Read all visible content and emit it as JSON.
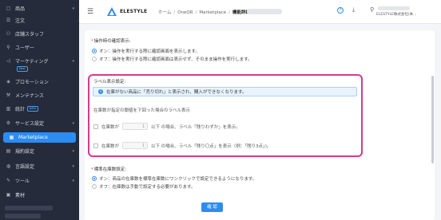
{
  "sidebar": {
    "items": [
      {
        "icon": "box-icon",
        "label": "商品",
        "chevron": true
      },
      {
        "icon": "list-icon",
        "label": "注文",
        "chevron": false
      },
      {
        "icon": "users-icon",
        "label": "店舗スタッフ",
        "chevron": false
      },
      {
        "icon": "user-icon",
        "label": "ユーザー",
        "chevron": false
      },
      {
        "icon": "megaphone-icon",
        "label": "マーケティング",
        "chevron": true,
        "sub_badge": "New"
      },
      {
        "icon": "gift-icon",
        "label": "プロモーション",
        "chevron": false
      },
      {
        "icon": "wrench-icon",
        "label": "メンテナンス",
        "chevron": false
      },
      {
        "icon": "chart-icon",
        "label": "統計",
        "chevron": false,
        "badge": "beta"
      },
      {
        "icon": "gear-icon",
        "label": "サービス設定",
        "chevron": true
      },
      {
        "icon": "store-icon",
        "label": "Marketplace",
        "chevron": false,
        "active": true
      },
      {
        "icon": "doc-icon",
        "label": "規約設定",
        "chevron": true
      },
      {
        "icon": "globe-icon",
        "label": "言語設定",
        "chevron": true
      },
      {
        "icon": "tool-icon",
        "label": "ツール",
        "chevron": true
      },
      {
        "icon": "image-icon",
        "label": "素材",
        "chevron": false
      }
    ]
  },
  "header": {
    "brand": "ELESTYLE",
    "breadcrumb": [
      "ホーム",
      "OneQR",
      "Marketplace",
      "機能詳細"
    ],
    "company": "ELESTYLE株式会社(本..."
  },
  "operation_confirm": {
    "title": "操作時の確認表示:",
    "options": [
      {
        "label": "オン：操作を実行する際に確認画面を表示します。",
        "selected": true
      },
      {
        "label": "オフ：操作を実行する際に確認画面は表示せず、そのまま操作を実行します。",
        "selected": false
      }
    ]
  },
  "label_display": {
    "title": "ラベル表示設定:",
    "info": "在庫がない商品に「売り切れ」と表示され、購入ができなくなります。",
    "desc": "在庫数が指定の閾値を下回った場合のラベル表示",
    "conditions": [
      {
        "prefix": "在庫数が",
        "value": "1",
        "suffix": "以下 の場合、ラベル「残りわずか」を表示。"
      },
      {
        "prefix": "在庫数が",
        "value": "1",
        "suffix": "以下 の場合、ラベル「残り〇点」を表示（例：「残り3点」)。"
      }
    ]
  },
  "standard_stock": {
    "title": "標準在庫数設定:",
    "options": [
      {
        "label": "オン：商品の在庫数を標準在庫数にワンクリックで設定できるようになります。",
        "selected": true
      },
      {
        "label": "オフ：在庫数は手動で設定する必要があります。",
        "selected": false
      }
    ]
  },
  "actions": {
    "confirm": "確 認"
  },
  "colors": {
    "primary": "#2d8cf0",
    "sidebar_bg": "#252b3b",
    "highlight": "#d63a8f",
    "required": "#e0393e"
  }
}
